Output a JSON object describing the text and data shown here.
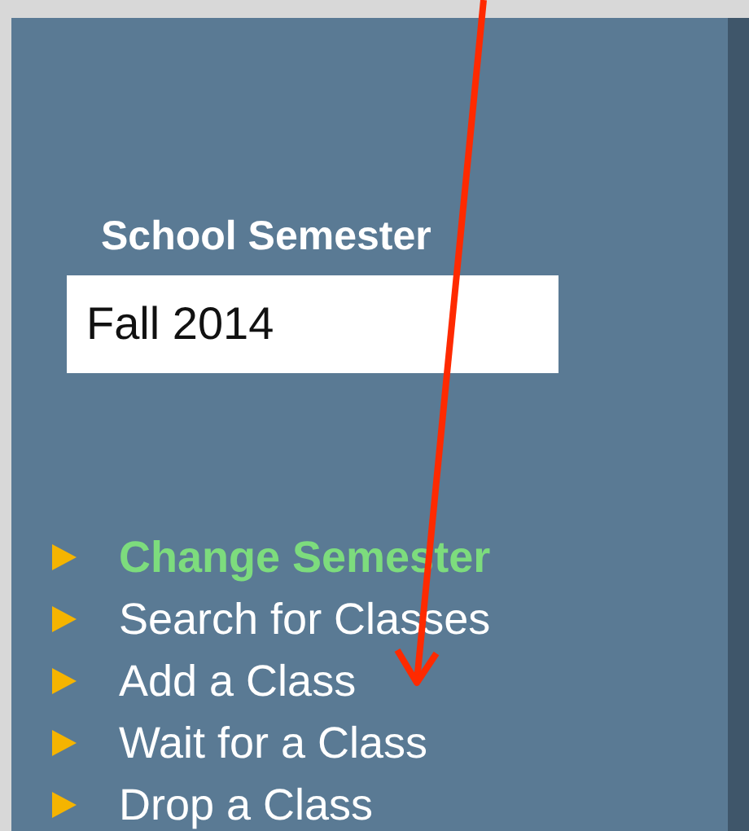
{
  "semester": {
    "label": "School Semester",
    "value": "Fall 2014"
  },
  "menu": [
    {
      "label": "Change Semester",
      "selected": true
    },
    {
      "label": "Search for Classes",
      "selected": false
    },
    {
      "label": "Add a Class",
      "selected": false
    },
    {
      "label": "Wait for a Class",
      "selected": false
    },
    {
      "label": "Drop a Class",
      "selected": false
    }
  ]
}
